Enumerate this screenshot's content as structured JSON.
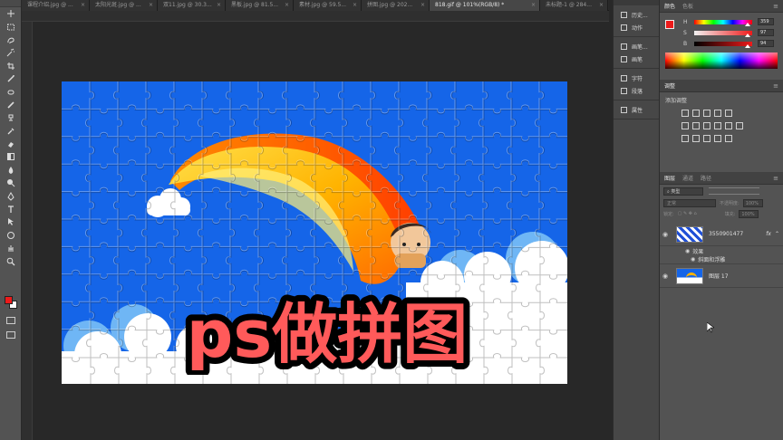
{
  "tabs": [
    {
      "label": "课程介绍.jpg @ ...",
      "active": false
    },
    {
      "label": "太阳光斑.jpg @ ...",
      "active": false
    },
    {
      "label": "双11.jpg @ 30.3...",
      "active": false
    },
    {
      "label": "黑板.jpg @ 81.5...",
      "active": false
    },
    {
      "label": "素材.jpg @ 59.5...",
      "active": false
    },
    {
      "label": "拼图.jpg @ 202...",
      "active": false
    },
    {
      "label": "818.gif @ 101%(RGB/8) *",
      "active": true
    },
    {
      "label": "未标题-1 @ 284...",
      "active": false
    }
  ],
  "tab_close_glyph": "×",
  "tools": [
    "move-icon",
    "marquee-icon",
    "lasso-icon",
    "magic-wand-icon",
    "crop-icon",
    "eyedropper-icon",
    "healing-icon",
    "brush-icon",
    "stamp-icon",
    "history-brush-icon",
    "eraser-icon",
    "gradient-icon",
    "blur-icon",
    "dodge-icon",
    "pen-icon",
    "type-icon",
    "path-select-icon",
    "shape-icon",
    "hand-icon",
    "zoom-icon"
  ],
  "icon_column": {
    "groups": [
      [
        {
          "icon": "history-icon",
          "label": "历史..."
        },
        {
          "icon": "actions-icon",
          "label": "动作"
        }
      ],
      [
        {
          "icon": "brush-preset-icon",
          "label": "画笔..."
        },
        {
          "icon": "brush-settings-icon",
          "label": "画笔"
        }
      ],
      [
        {
          "icon": "character-icon",
          "label": "字符"
        },
        {
          "icon": "paragraph-icon",
          "label": "段落"
        }
      ],
      [
        {
          "icon": "properties-icon",
          "label": "属性"
        }
      ]
    ]
  },
  "color_panel": {
    "tabs": [
      "颜色",
      "色板"
    ],
    "sliders": [
      {
        "label": "H",
        "value": "359"
      },
      {
        "label": "S",
        "value": "97"
      },
      {
        "label": "B",
        "value": "94"
      }
    ],
    "foreground": "#ee1a1a",
    "background": "#ffffff"
  },
  "adjustments_panel": {
    "tab": "调整",
    "title": "添加调整"
  },
  "layers_panel": {
    "tabs": [
      "图层",
      "通道",
      "路径"
    ],
    "filter_label": "类型",
    "blend_mode": "正常",
    "opacity_label": "不透明度:",
    "opacity_value": "100%",
    "lock_label": "锁定:",
    "fill_label": "填充:",
    "fill_value": "100%",
    "layers": [
      {
        "name": "3550901477",
        "fx": "fx",
        "thumb": "pattern"
      },
      {
        "name": "效果",
        "sub": true
      },
      {
        "name": "斜面和浮雕",
        "sub": true
      },
      {
        "name": "图层 17",
        "thumb": "image"
      }
    ]
  },
  "canvas": {
    "headline": "ps做拼图",
    "sky_color": "#1565e8",
    "headline_color": "#ff5a5a"
  }
}
